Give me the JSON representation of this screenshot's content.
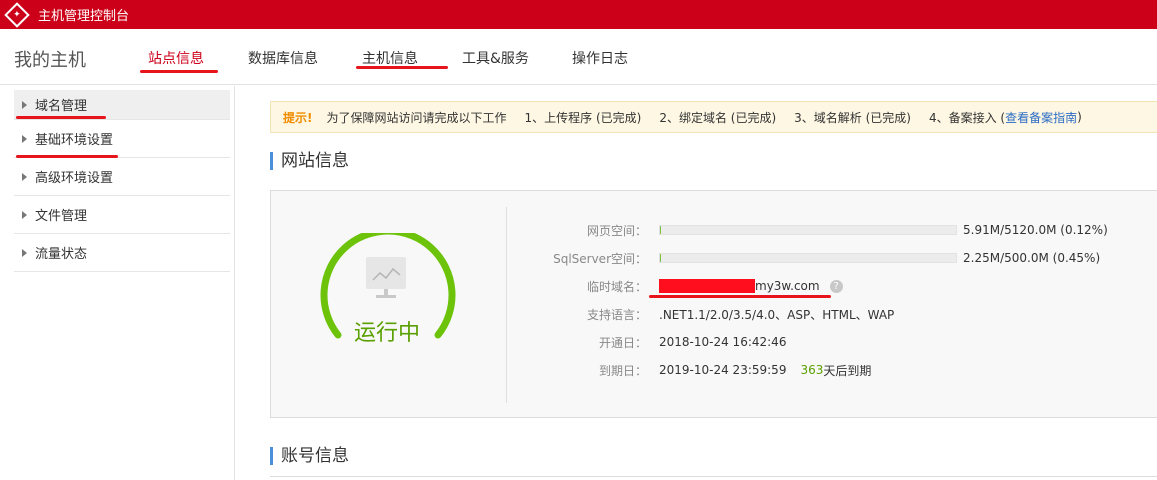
{
  "app": {
    "title": "主机管理控制台"
  },
  "nav": {
    "host_title": "我的主机",
    "tabs": [
      {
        "label": "站点信息",
        "active": true
      },
      {
        "label": "数据库信息",
        "active": false
      },
      {
        "label": "主机信息",
        "active": false
      },
      {
        "label": "工具&服务",
        "active": false
      },
      {
        "label": "操作日志",
        "active": false
      }
    ]
  },
  "sidebar": {
    "items": [
      {
        "label": "域名管理"
      },
      {
        "label": "基础环境设置"
      },
      {
        "label": "高级环境设置"
      },
      {
        "label": "文件管理"
      },
      {
        "label": "流量状态"
      }
    ]
  },
  "notice": {
    "label": "提示!",
    "text": "为了保障网站访问请完成以下工作",
    "steps": [
      "1、上传程序 (已完成)",
      "2、绑定域名 (已完成)",
      "3、域名解析 (已完成)",
      "4、备案接入 ("
    ],
    "link": "查看备案指南",
    "link_suffix": ")"
  },
  "site_info": {
    "title": "网站信息",
    "status": "运行中",
    "web_space": {
      "label": "网页空间：",
      "value": "5.91M/5120.0M (0.12%)",
      "percent": 0.12
    },
    "sql_space": {
      "label": "SqlServer空间：",
      "value": "2.25M/500.0M (0.45%)",
      "percent": 0.45
    },
    "temp_domain": {
      "label": "临时域名：",
      "value": "my3w.com"
    },
    "languages": {
      "label": "支持语言：",
      "value": ".NET1.1/2.0/3.5/4.0、ASP、HTML、WAP"
    },
    "open_date": {
      "label": "开通日：",
      "value": "2018-10-24 16:42:46"
    },
    "expire_date": {
      "label": "到期日：",
      "value": "2019-10-24 23:59:59",
      "days": "363",
      "days_suffix": "天后到期"
    }
  },
  "account_info": {
    "title": "账号信息"
  },
  "colors": {
    "brand_red": "#cc0018",
    "status_green": "#5aa000",
    "gauge_green": "#6cc30a",
    "link_blue": "#2b6cc4"
  },
  "icons": {
    "logo": "host-logo-icon",
    "monitor": "monitor-chart-icon",
    "help": "question-icon"
  }
}
